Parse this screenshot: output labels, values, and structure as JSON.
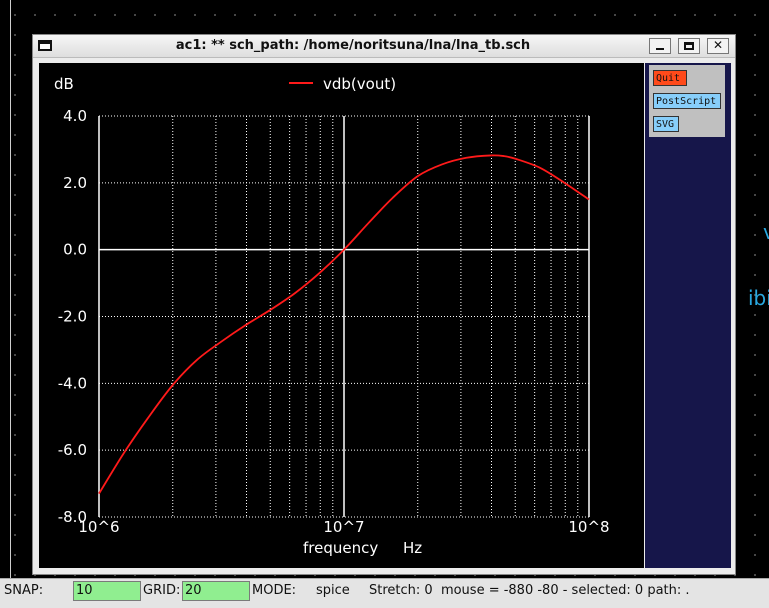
{
  "window": {
    "title": "ac1: ** sch_path: /home/noritsuna/lna/lna_tb.sch"
  },
  "panel": {
    "quit": "Quit",
    "postscript": "PostScript",
    "svg": "SVG"
  },
  "background": {
    "frag1": "v",
    "frag2": "ibi"
  },
  "chart_data": {
    "type": "line",
    "ylabel": "dB",
    "xlabel": "frequency",
    "xunit": "Hz",
    "xscale": "log",
    "xlim": [
      1000000,
      100000000
    ],
    "ylim": [
      -8.0,
      4.0
    ],
    "yticks": [
      "4.0",
      "2.0",
      "0.0",
      "-2.0",
      "-4.0",
      "-6.0",
      "-8.0"
    ],
    "xticks": [
      "10^6",
      "10^7",
      "10^8"
    ],
    "grid": true,
    "legend_position": "top-center",
    "series": [
      {
        "name": "vdb(vout)",
        "color": "#ff1a1a",
        "x": [
          1000000,
          1260000,
          1580000,
          2000000,
          2510000,
          3160000,
          3980000,
          5010000,
          6310000,
          7940000,
          10000000,
          12600000,
          15800000,
          20000000,
          25100000,
          31600000,
          39800000,
          45000000,
          50100000,
          63100000,
          79400000,
          100000000
        ],
        "y": [
          -7.3,
          -6.1,
          -5.05,
          -4.05,
          -3.3,
          -2.75,
          -2.25,
          -1.8,
          -1.3,
          -0.7,
          0.0,
          0.8,
          1.55,
          2.2,
          2.55,
          2.75,
          2.82,
          2.8,
          2.72,
          2.45,
          2.0,
          1.5
        ]
      }
    ]
  },
  "status": {
    "snap_label": "SNAP:",
    "snap_value": "10",
    "grid_label": "GRID:",
    "grid_value": "20",
    "mode_label": "MODE:",
    "mode_value": "spice",
    "info": "Stretch: 0  mouse = -880 -80 - selected: 0 path: ."
  }
}
